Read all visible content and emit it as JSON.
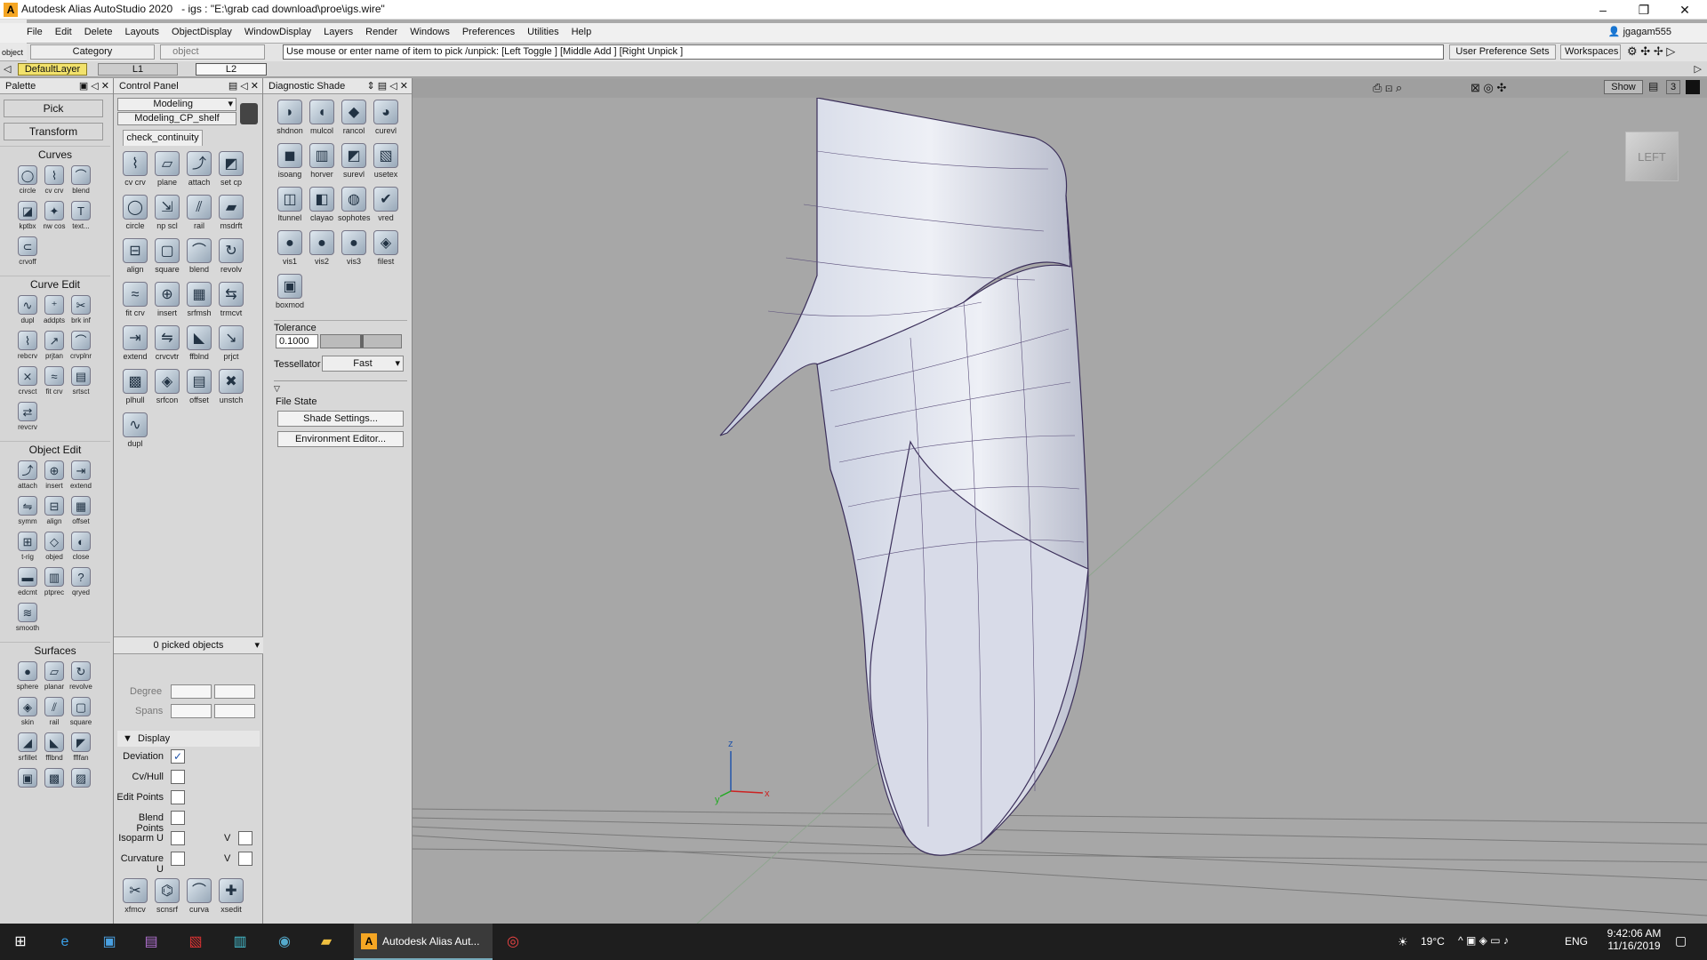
{
  "window": {
    "title": "Autodesk Alias AutoStudio 2020",
    "file": "- igs : \"E:\\grab cad download\\proe\\igs.wire\"",
    "min": "–",
    "max": "❐",
    "close": "✕"
  },
  "menu": [
    "File",
    "Edit",
    "Delete",
    "Layouts",
    "ObjectDisplay",
    "WindowDisplay",
    "Layers",
    "Render",
    "Windows",
    "Preferences",
    "Utilities",
    "Help"
  ],
  "user": "jgagam555",
  "object_label": "object",
  "category_label": "Category",
  "object_field": "object",
  "command_line": "Use mouse or enter name of item to pick /unpick: [Left Toggle ] [Middle Add ] [Right Unpick ]",
  "user_pref_sets": "User Preference Sets",
  "workspaces": "Workspaces",
  "layers": {
    "default": "DefaultLayer",
    "l1": "L1",
    "l2": "L2"
  },
  "palette": {
    "title": "Palette",
    "pick": "Pick",
    "transform": "Transform",
    "sections": [
      {
        "name": "Curves",
        "tools": [
          {
            "l": "circle",
            "i": "◯"
          },
          {
            "l": "cv crv",
            "i": "⌇"
          },
          {
            "l": "blend",
            "i": "⌒"
          },
          {
            "l": "kptbx",
            "i": "◪"
          },
          {
            "l": "nw cos",
            "i": "✦"
          },
          {
            "l": "text...",
            "i": "T"
          },
          {
            "l": "crvoff",
            "i": "⊂"
          }
        ]
      },
      {
        "name": "Curve Edit",
        "tools": [
          {
            "l": "dupl",
            "i": "∿"
          },
          {
            "l": "addpts",
            "i": "⁺"
          },
          {
            "l": "brk inf",
            "i": "✂"
          },
          {
            "l": "rebcrv",
            "i": "⌇"
          },
          {
            "l": "prjtan",
            "i": "↗"
          },
          {
            "l": "crvplnr",
            "i": "⌒"
          },
          {
            "l": "crvsct",
            "i": "⨯"
          },
          {
            "l": "fit crv",
            "i": "≈"
          },
          {
            "l": "srtsct",
            "i": "▤"
          },
          {
            "l": "revcrv",
            "i": "⇄"
          }
        ]
      },
      {
        "name": "Object Edit",
        "tools": [
          {
            "l": "attach",
            "i": "⤴"
          },
          {
            "l": "insert",
            "i": "⊕"
          },
          {
            "l": "extend",
            "i": "⇥"
          },
          {
            "l": "symm",
            "i": "⇋"
          },
          {
            "l": "align",
            "i": "⊟"
          },
          {
            "l": "offset",
            "i": "▦"
          },
          {
            "l": "t-rig",
            "i": "⊞"
          },
          {
            "l": "objed",
            "i": "◇"
          },
          {
            "l": "close",
            "i": "◐"
          },
          {
            "l": "edcmt",
            "i": "▬"
          },
          {
            "l": "ptprec",
            "i": "▥"
          },
          {
            "l": "qryed",
            "i": "?"
          },
          {
            "l": "smooth",
            "i": "≋"
          }
        ]
      },
      {
        "name": "Surfaces",
        "tools": [
          {
            "l": "sphere",
            "i": "●"
          },
          {
            "l": "planar",
            "i": "▱"
          },
          {
            "l": "revolve",
            "i": "↻"
          },
          {
            "l": "skin",
            "i": "◈"
          },
          {
            "l": "rail",
            "i": "⫽"
          },
          {
            "l": "square",
            "i": "▢"
          },
          {
            "l": "srfillet",
            "i": "◢"
          },
          {
            "l": "fflbnd",
            "i": "◣"
          },
          {
            "l": "fflfan",
            "i": "◤"
          },
          {
            "l": "",
            "i": "▣"
          },
          {
            "l": "",
            "i": "▩"
          },
          {
            "l": "",
            "i": "▨"
          }
        ]
      }
    ]
  },
  "control_panel": {
    "title": "Control Panel",
    "mode": "Modeling",
    "shelf": "Modeling_CP_shelf",
    "tab": "check_continuity",
    "tools": [
      {
        "l": "cv crv",
        "i": "⌇"
      },
      {
        "l": "plane",
        "i": "▱"
      },
      {
        "l": "attach",
        "i": "⤴"
      },
      {
        "l": "set cp",
        "i": "◩"
      },
      {
        "l": "circle",
        "i": "◯"
      },
      {
        "l": "np scl",
        "i": "⇲"
      },
      {
        "l": "rail",
        "i": "⫽"
      },
      {
        "l": "msdrft",
        "i": "▰"
      },
      {
        "l": "align",
        "i": "⊟"
      },
      {
        "l": "square",
        "i": "▢"
      },
      {
        "l": "blend",
        "i": "⌒"
      },
      {
        "l": "revolv",
        "i": "↻"
      },
      {
        "l": "fit crv",
        "i": "≈"
      },
      {
        "l": "insert",
        "i": "⊕"
      },
      {
        "l": "srfmsh",
        "i": "▦"
      },
      {
        "l": "trmcvt",
        "i": "⇆"
      },
      {
        "l": "extend",
        "i": "⇥"
      },
      {
        "l": "crvcvtr",
        "i": "⇋"
      },
      {
        "l": "ffblnd",
        "i": "◣"
      },
      {
        "l": "prjct",
        "i": "↘"
      },
      {
        "l": "plhull",
        "i": "▩"
      },
      {
        "l": "srfcon",
        "i": "◈"
      },
      {
        "l": "offset",
        "i": "▤"
      },
      {
        "l": "unstch",
        "i": "✖"
      },
      {
        "l": "dupl",
        "i": "∿"
      }
    ],
    "picked": "0 picked objects",
    "degree": "Degree",
    "spans": "Spans",
    "display": "Display",
    "display_items": [
      {
        "l": "Deviation",
        "c": true
      },
      {
        "l": "Cv/Hull",
        "c": false
      },
      {
        "l": "Edit Points",
        "c": false
      },
      {
        "l": "Blend Points",
        "c": false
      },
      {
        "l": "Isoparm U",
        "c": false,
        "v": true
      },
      {
        "l": "Curvature U",
        "c": false,
        "v": true
      }
    ],
    "v_label": "V",
    "bottom_tools": [
      {
        "l": "xfmcv",
        "i": "✂"
      },
      {
        "l": "scnsrf",
        "i": "⌬"
      },
      {
        "l": "curva",
        "i": "⌒"
      },
      {
        "l": "xsedit",
        "i": "✚"
      }
    ]
  },
  "diag": {
    "title": "Diagnostic Shade",
    "tools": [
      {
        "l": "shdnon",
        "i": "◗"
      },
      {
        "l": "mulcol",
        "i": "◖"
      },
      {
        "l": "rancol",
        "i": "◆"
      },
      {
        "l": "curevl",
        "i": "◕"
      },
      {
        "l": "isoang",
        "i": "◼"
      },
      {
        "l": "horver",
        "i": "▥"
      },
      {
        "l": "surevl",
        "i": "◩"
      },
      {
        "l": "usetex",
        "i": "▧"
      },
      {
        "l": "ltunnel",
        "i": "◫"
      },
      {
        "l": "clayao",
        "i": "◧"
      },
      {
        "l": "sophotes",
        "i": "◍"
      },
      {
        "l": "vred",
        "i": "✔"
      },
      {
        "l": "vis1",
        "i": "●"
      },
      {
        "l": "vis2",
        "i": "●"
      },
      {
        "l": "vis3",
        "i": "●"
      },
      {
        "l": "filest",
        "i": "◈"
      },
      {
        "l": "boxmod",
        "i": "▣"
      }
    ],
    "tolerance": "Tolerance",
    "tol_val": "0.1000",
    "tessellator": "Tessellator",
    "tess_val": "Fast",
    "file_state": "File State",
    "shade_settings": "Shade Settings...",
    "env_editor": "Environment Editor..."
  },
  "viewport": {
    "show": "Show",
    "layout_num": "3",
    "viewcube": "LEFT",
    "axis_z": "z",
    "axis_y": "y",
    "axis_x": "x"
  },
  "taskbar": {
    "app": "Autodesk Alias Aut...",
    "temp": "19°C",
    "lang": "ENG",
    "time": "9:42:06 AM",
    "date": "11/16/2019"
  }
}
